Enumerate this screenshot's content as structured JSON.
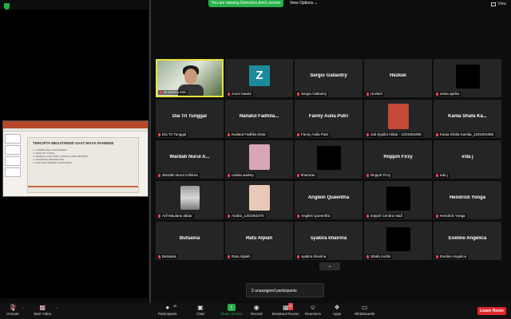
{
  "top": {
    "share_banner": "You are viewing Dominica Ami's screen",
    "view_options": "View Options ⌄",
    "view_label": "View"
  },
  "presentation": {
    "slide_title": "TERCIPTA MEGATREND SAAT MASA PANDEMI",
    "bullets": [
      "1. CONNECTED CONSUMERS",
      "2. HEALTHY LIVING",
      "3. MIDDLE CLASS AND LOWER CLASS RETREAT",
      "4. SHOPPING REINVENTED",
      "5. SHIFTING MARKET FRONTIERS"
    ]
  },
  "gallery": {
    "tiles": [
      {
        "type": "video",
        "label": "Dominica Ami",
        "active": true
      },
      {
        "type": "avatar",
        "avatar_letter": "Z",
        "label": "zoom baa04"
      },
      {
        "type": "name",
        "name": "Sergio Gallantry",
        "label": "Sergio Gallantry"
      },
      {
        "type": "name",
        "name": "Hezkiel",
        "label": "Hezkiel"
      },
      {
        "type": "black",
        "label": "anisa aprilia"
      },
      {
        "type": "name",
        "name": "Dia Tri Tunggal",
        "label": "Dia Tri Tunggal"
      },
      {
        "type": "name",
        "name": "Nailatul Fadhila...",
        "label": "Nailatul Fadhila Dista"
      },
      {
        "type": "name",
        "name": "Fanny Aulia Putri",
        "label": "Fanny Aulia Putri"
      },
      {
        "type": "photo",
        "photo_color": "#c24a36",
        "label": "Jati Syaiful Akbar - 1201001005"
      },
      {
        "type": "name",
        "name": "Kania Shafa Ka...",
        "label": "Kania Shafa Kamila_1201001055"
      },
      {
        "type": "name",
        "name": "Wardah Nurul A...",
        "label": "Wardah Nurul Azhilma"
      },
      {
        "type": "photo",
        "photo_color": "#d8a6b8",
        "label": "calista audrey"
      },
      {
        "type": "black",
        "label": "khamran"
      },
      {
        "type": "name",
        "name": "Riqqoh Firzy",
        "label": "Riqqoh Firzy"
      },
      {
        "type": "name",
        "name": "irda j",
        "label": "irda j"
      },
      {
        "type": "blurred",
        "label": "Arif Maulana akbar"
      },
      {
        "type": "photo",
        "photo_color": "#e8c9b8",
        "label": "Andira_1201001070"
      },
      {
        "type": "name",
        "name": "Anglein Queentha",
        "label": "Anglein Queentha"
      },
      {
        "type": "black",
        "label": "inayah Cendra Hadi"
      },
      {
        "type": "name",
        "name": "Hendrick Yonga",
        "label": "Hendrick Yonga"
      },
      {
        "type": "name",
        "name": "Butsaina",
        "label": "Butsaina"
      },
      {
        "type": "name",
        "name": "Ratu Alpiah",
        "label": "Ratu Alpiah"
      },
      {
        "type": "name",
        "name": "syakira khairina",
        "label": "syakira khairina"
      },
      {
        "type": "black",
        "label": "Shafa Andini"
      },
      {
        "type": "name",
        "name": "Eveline Angelica",
        "label": "Eveline Angelica"
      }
    ]
  },
  "scroll_down_icon": "⌄",
  "unassigned": "2 unassigned participants",
  "toolbar": {
    "unmute": "Unmute",
    "start_video": "Start Video",
    "participants": "Participants",
    "participants_count": "45",
    "chat": "Chat",
    "share_screen": "Share Screen",
    "record": "Record",
    "breakout_rooms": "Breakout Rooms",
    "breakout_badge": "42",
    "reactions": "Reactions",
    "apps": "Apps",
    "whiteboards": "Whiteboards",
    "leave": "Leave Room"
  },
  "colors": {
    "accent_green": "#26b14a",
    "leave_red": "#e02828",
    "active_speaker": "#e8e23a"
  }
}
